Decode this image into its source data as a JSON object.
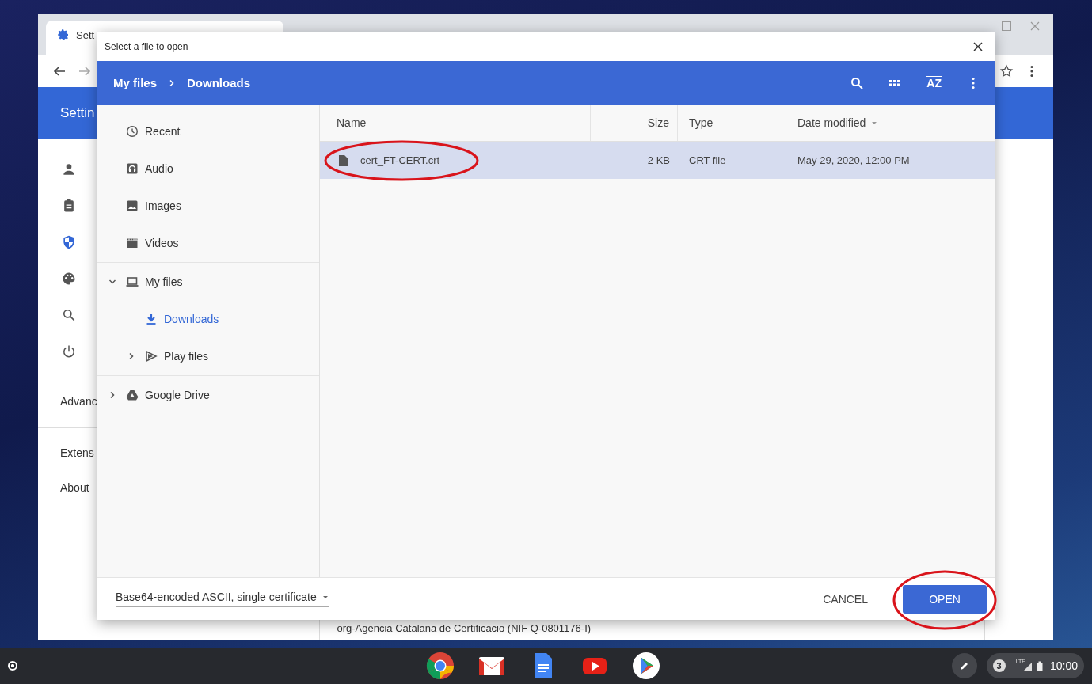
{
  "browser_window": {
    "tab_title": "Sett",
    "header_title": "Settin",
    "sidebar_links": [
      "Advanc",
      "Extens",
      "About"
    ],
    "background_text": "org-Agencia Catalana de Certificacio (NIF Q-0801176-I)"
  },
  "dialog": {
    "title": "Select a file to open",
    "breadcrumb": [
      "My files",
      "Downloads"
    ],
    "sort_label": "AZ",
    "nav_sections": [
      {
        "items": [
          {
            "label": "Recent",
            "selected": false
          },
          {
            "label": "Audio",
            "selected": false
          },
          {
            "label": "Images",
            "selected": false
          },
          {
            "label": "Videos",
            "selected": false
          }
        ]
      },
      {
        "items": [
          {
            "label": "My files",
            "selected": false,
            "expanded": true,
            "children": [
              {
                "label": "Downloads",
                "selected": true
              },
              {
                "label": "Play files",
                "selected": false,
                "expanded": false
              }
            ]
          }
        ]
      },
      {
        "items": [
          {
            "label": "Google Drive",
            "selected": false,
            "expanded": false
          }
        ]
      }
    ],
    "columns": [
      {
        "label": "Name",
        "sorted": false
      },
      {
        "label": "Size",
        "sorted": false
      },
      {
        "label": "Type",
        "sorted": false
      },
      {
        "label": "Date modified",
        "sorted": true
      }
    ],
    "files": [
      {
        "name": "cert_FT-CERT.crt",
        "size": "2 KB",
        "type": "CRT file",
        "date": "May 29, 2020, 12:00 PM",
        "selected": true
      }
    ],
    "file_type": "Base64-encoded ASCII, single certificate",
    "cancel_label": "CANCEL",
    "open_label": "OPEN"
  },
  "shelf": {
    "notification_count": "3",
    "network_label": "LTE",
    "time": "10:00"
  }
}
